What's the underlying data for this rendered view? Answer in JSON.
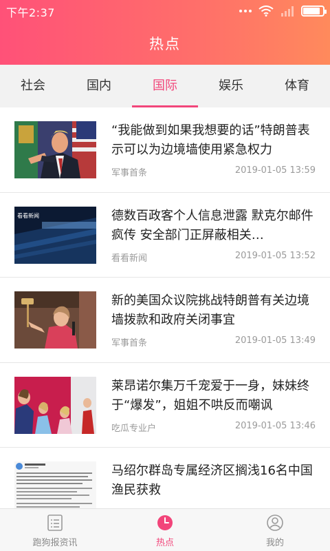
{
  "status_bar": {
    "time": "下午2:37",
    "icons": [
      "more-dots-icon",
      "wifi-icon",
      "signal-icon",
      "battery-icon"
    ],
    "battery_level": 0.85
  },
  "header": {
    "title": "热点"
  },
  "tabs": [
    {
      "label": "社会",
      "active": false
    },
    {
      "label": "国内",
      "active": false
    },
    {
      "label": "国际",
      "active": true
    },
    {
      "label": "娱乐",
      "active": false
    },
    {
      "label": "体育",
      "active": false
    }
  ],
  "news": [
    {
      "title": "“我能做到如果我想要的话”特朗普表示可以为边境墙使用紧急权力",
      "source": "军事首条",
      "time": "2019-01-05 13:59",
      "thumb": "trump-pointing-photo"
    },
    {
      "title": "德数百政客个人信息泄露 默克尔邮件疯传 安全部门正屏蔽相关…",
      "source": "看看新闻",
      "time": "2019-01-05 13:52",
      "thumb": "keyboard-photo",
      "thumb_caption": "看看新闻"
    },
    {
      "title": "新的美国众议院挑战特朗普有关边境墙拨款和政府关闭事宜",
      "source": "军事首条",
      "time": "2019-01-05 13:49",
      "thumb": "speaker-gavel-photo"
    },
    {
      "title": "莱昂诺尔集万千宠爱于一身，妹妹终于“爆发”，姐姐不哄反而嘲讽",
      "source": "吃瓜专业户",
      "time": "2019-01-05 13:46",
      "thumb": "royal-family-photo"
    },
    {
      "title": "马绍尔群岛专属经济区搁浅16名中国渔民获救",
      "source": "",
      "time": "",
      "thumb": "weibo-screenshot-photo"
    }
  ],
  "bottom_nav": [
    {
      "label": "跑狗报资讯",
      "icon": "list-icon",
      "active": false
    },
    {
      "label": "热点",
      "icon": "clock-icon",
      "active": true
    },
    {
      "label": "我的",
      "icon": "user-icon",
      "active": false
    }
  ],
  "colors": {
    "accent": "#f2457a",
    "header_gradient_start": "#ff5178",
    "header_gradient_end": "#ff8a5c"
  }
}
